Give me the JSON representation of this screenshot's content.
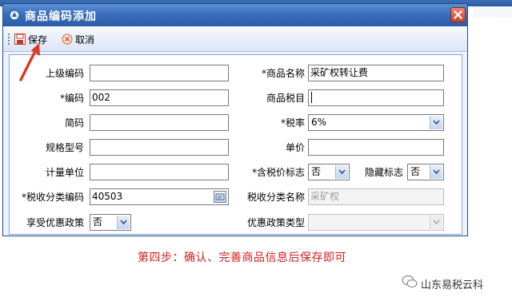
{
  "dialog": {
    "title": "商品编码添加",
    "close_label": "×"
  },
  "toolbar": {
    "save_label": "保存",
    "cancel_label": "取消"
  },
  "form": {
    "parent_code_label": "上级编码",
    "parent_code_value": "",
    "product_name_label": "*商品名称",
    "product_name_value": "采矿权转让费",
    "code_label": "*编码",
    "code_value": "002",
    "tax_item_label": "商品税目",
    "tax_item_value": "",
    "short_code_label": "简码",
    "short_code_value": "",
    "tax_rate_label": "*税率",
    "tax_rate_value": "6%",
    "spec_label": "规格型号",
    "spec_value": "",
    "unit_price_label": "单价",
    "unit_price_value": "",
    "unit_label": "计量单位",
    "unit_value": "",
    "tax_included_label": "*含税价标志",
    "tax_included_value": "否",
    "hidden_flag_label": "隐藏标志",
    "hidden_flag_value": "否",
    "tax_class_code_label": "*税收分类编码",
    "tax_class_code_value": "40503",
    "tax_class_name_label": "税收分类名称",
    "tax_class_name_value": "采矿权",
    "preferential_label": "享受优惠政策",
    "preferential_value": "否",
    "preferential_type_label": "优惠政策类型",
    "preferential_type_value": ""
  },
  "caption": "第四步：确认、完善商品信息后保存即可",
  "brand": "山东易税云科",
  "colors": {
    "titlebar": "#3a6fbd",
    "caption": "#d21e1e",
    "annotation_arrow": "#d83a2a"
  },
  "icons": {
    "title": "app-icon",
    "save": "save-icon",
    "cancel": "cancel-icon",
    "lookup": "lookup-icon",
    "brand": "wechat-icon"
  }
}
